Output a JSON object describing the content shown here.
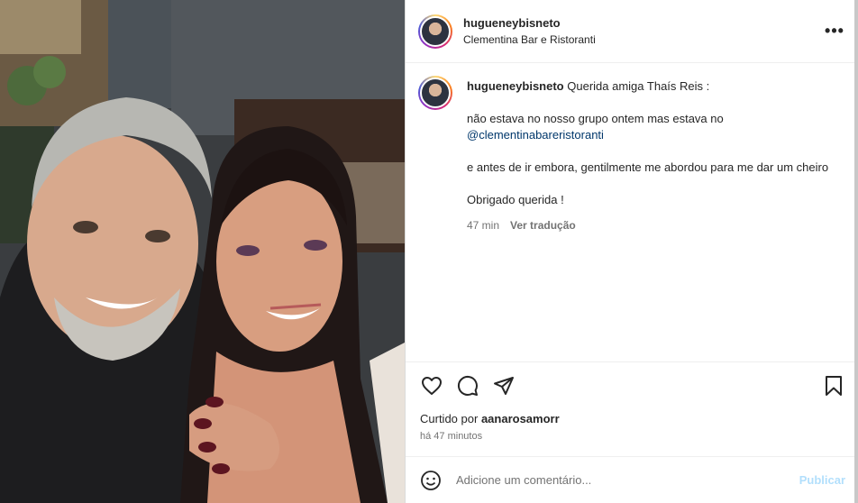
{
  "post": {
    "username": "hugueneybisneto",
    "location": "Clementina Bar e Ristoranti",
    "more_glyph": "•••"
  },
  "caption": {
    "username": "hugueneybisneto",
    "line1": "Querida amiga Thaís Reis :",
    "line2": "não estava no nosso grupo ontem mas estava no",
    "mention": "@clementinabareristoranti",
    "line3": "e antes de ir embora, gentilmente me abordou para me dar um cheiro",
    "line4": "Obrigado querida !",
    "age": "47 min",
    "translate": "Ver tradução"
  },
  "likes": {
    "prefix": "Curtido por",
    "user": "aanarosamorr"
  },
  "timestamp": "há 47 minutos",
  "comment_box": {
    "placeholder": "Adicione um comentário...",
    "publish": "Publicar"
  },
  "icons": {
    "like": "heart-icon",
    "comment": "comment-icon",
    "share": "send-icon",
    "save": "bookmark-icon",
    "emoji": "emoji-icon",
    "more": "more-icon"
  },
  "colors": {
    "story_ring": [
      "#feda75",
      "#fa7e1e",
      "#d62976",
      "#962fbf",
      "#4f5bd5"
    ],
    "mention": "#00376b",
    "publish_disabled": "#b2dffc",
    "muted": "#737373"
  }
}
